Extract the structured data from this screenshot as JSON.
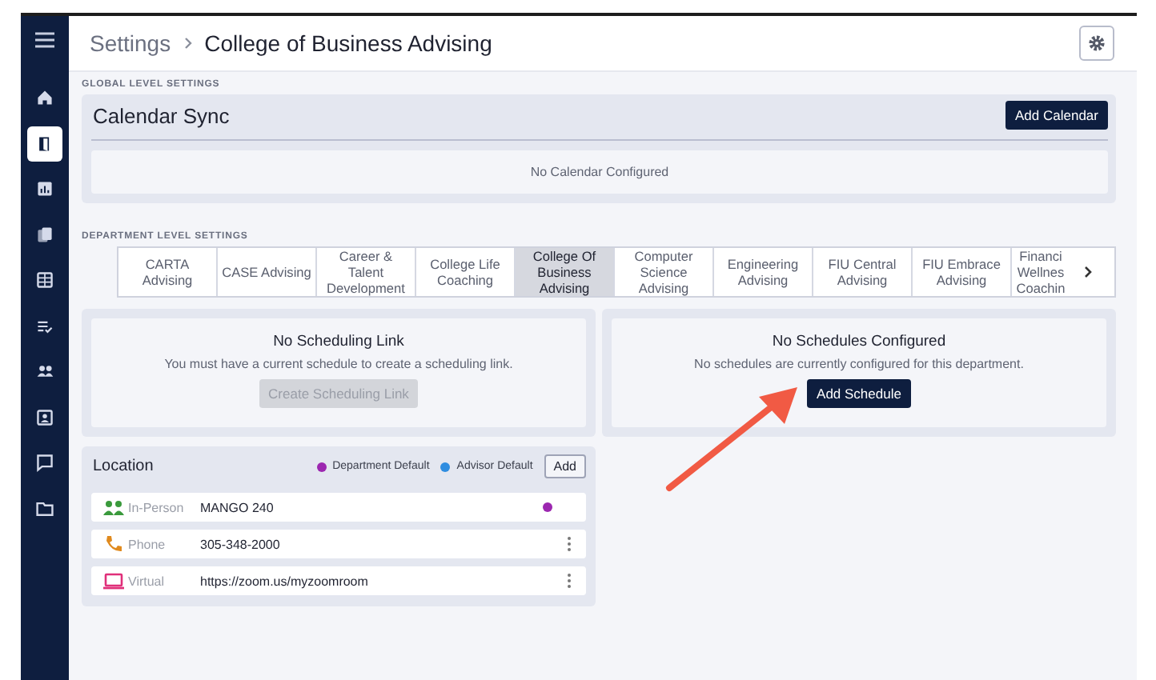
{
  "breadcrumb": {
    "parent": "Settings",
    "current": "College of Business Advising"
  },
  "sidebar": {
    "items": [
      {
        "selected": false
      },
      {
        "selected": true
      },
      {
        "selected": false
      },
      {
        "selected": false
      },
      {
        "selected": false
      },
      {
        "selected": false
      },
      {
        "selected": false
      },
      {
        "selected": false
      },
      {
        "selected": false
      },
      {
        "selected": false
      }
    ]
  },
  "global_settings": {
    "heading": "GLOBAL LEVEL SETTINGS",
    "calendar_sync": {
      "title": "Calendar Sync",
      "button": "Add Calendar",
      "empty_message": "No Calendar Configured"
    }
  },
  "department_settings": {
    "heading": "DEPARTMENT LEVEL SETTINGS",
    "tabs": [
      {
        "label": "CARTA Advising",
        "selected": false
      },
      {
        "label": "CASE Advising",
        "selected": false
      },
      {
        "label": "Career & Talent Development",
        "selected": false
      },
      {
        "label": "College Life Coaching",
        "selected": false
      },
      {
        "label": "College Of Business Advising",
        "selected": true
      },
      {
        "label": "Computer Science Advising",
        "selected": false
      },
      {
        "label": "Engineering Advising",
        "selected": false
      },
      {
        "label": "FIU Central Advising",
        "selected": false
      },
      {
        "label": "FIU Embrace Advising",
        "selected": false
      },
      {
        "label": "Financi Wellnes Coachin",
        "selected": false
      }
    ],
    "scheduling_link": {
      "title": "No Scheduling Link",
      "message": "You must have a current schedule to create a scheduling link.",
      "button": "Create Scheduling Link",
      "button_disabled": true
    },
    "schedules": {
      "title": "No Schedules Configured",
      "message": "No schedules are currently configured for this department.",
      "button": "Add Schedule"
    },
    "location": {
      "title": "Location",
      "legend": [
        {
          "label": "Department Default",
          "color": "#9c27b0"
        },
        {
          "label": "Advisor Default",
          "color": "#2f8de0"
        }
      ],
      "button": "Add",
      "rows": [
        {
          "kind": "in-person",
          "type": "In-Person",
          "value": "MANGO 240",
          "department_default": true
        },
        {
          "kind": "phone",
          "type": "Phone",
          "value": "305-348-2000",
          "department_default": false
        },
        {
          "kind": "virtual",
          "type": "Virtual",
          "value": "https://zoom.us/myzoomroom",
          "department_default": false
        }
      ]
    }
  }
}
